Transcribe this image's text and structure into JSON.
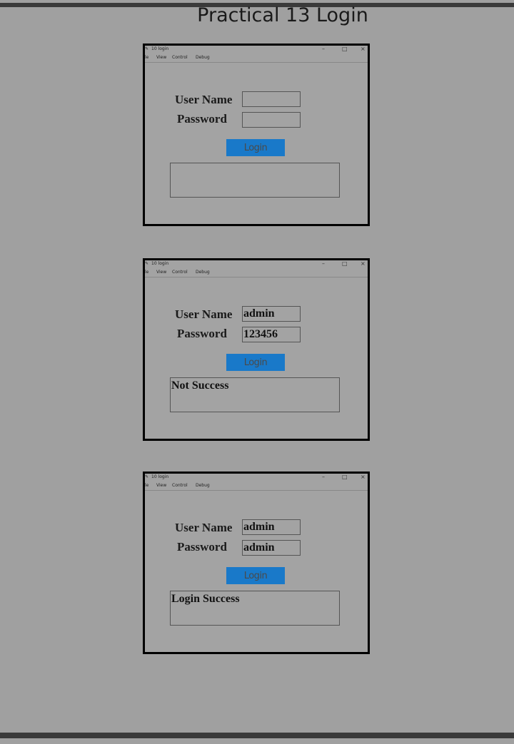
{
  "page_title": "Practical 13 Login",
  "windows": [
    {
      "title": "10 login",
      "menu": [
        "le",
        "View",
        "Control",
        "Debug"
      ],
      "controls": {
        "min": "–",
        "max": "□",
        "close": "×"
      },
      "user_label": "User Name",
      "pass_label": "Password",
      "user_value": "",
      "pass_value": "",
      "button_label": "Login",
      "output": ""
    },
    {
      "title": "10 login",
      "menu": [
        "le",
        "View",
        "Control",
        "Debug"
      ],
      "controls": {
        "min": "–",
        "max": "□",
        "close": "×"
      },
      "user_label": "User Name",
      "pass_label": "Password",
      "user_value": "admin",
      "pass_value": "123456",
      "button_label": "Login",
      "output": "Not Success"
    },
    {
      "title": "10 login",
      "menu": [
        "le",
        "View",
        "Control",
        "Debug"
      ],
      "controls": {
        "min": "–",
        "max": "□",
        "close": "×"
      },
      "user_label": "User Name",
      "pass_label": "Password",
      "user_value": "admin",
      "pass_value": "admin",
      "button_label": "Login",
      "output": "Login Success"
    }
  ],
  "colors": {
    "button": "#1979c9",
    "background": "#a0a0a0",
    "border": "#000000"
  }
}
